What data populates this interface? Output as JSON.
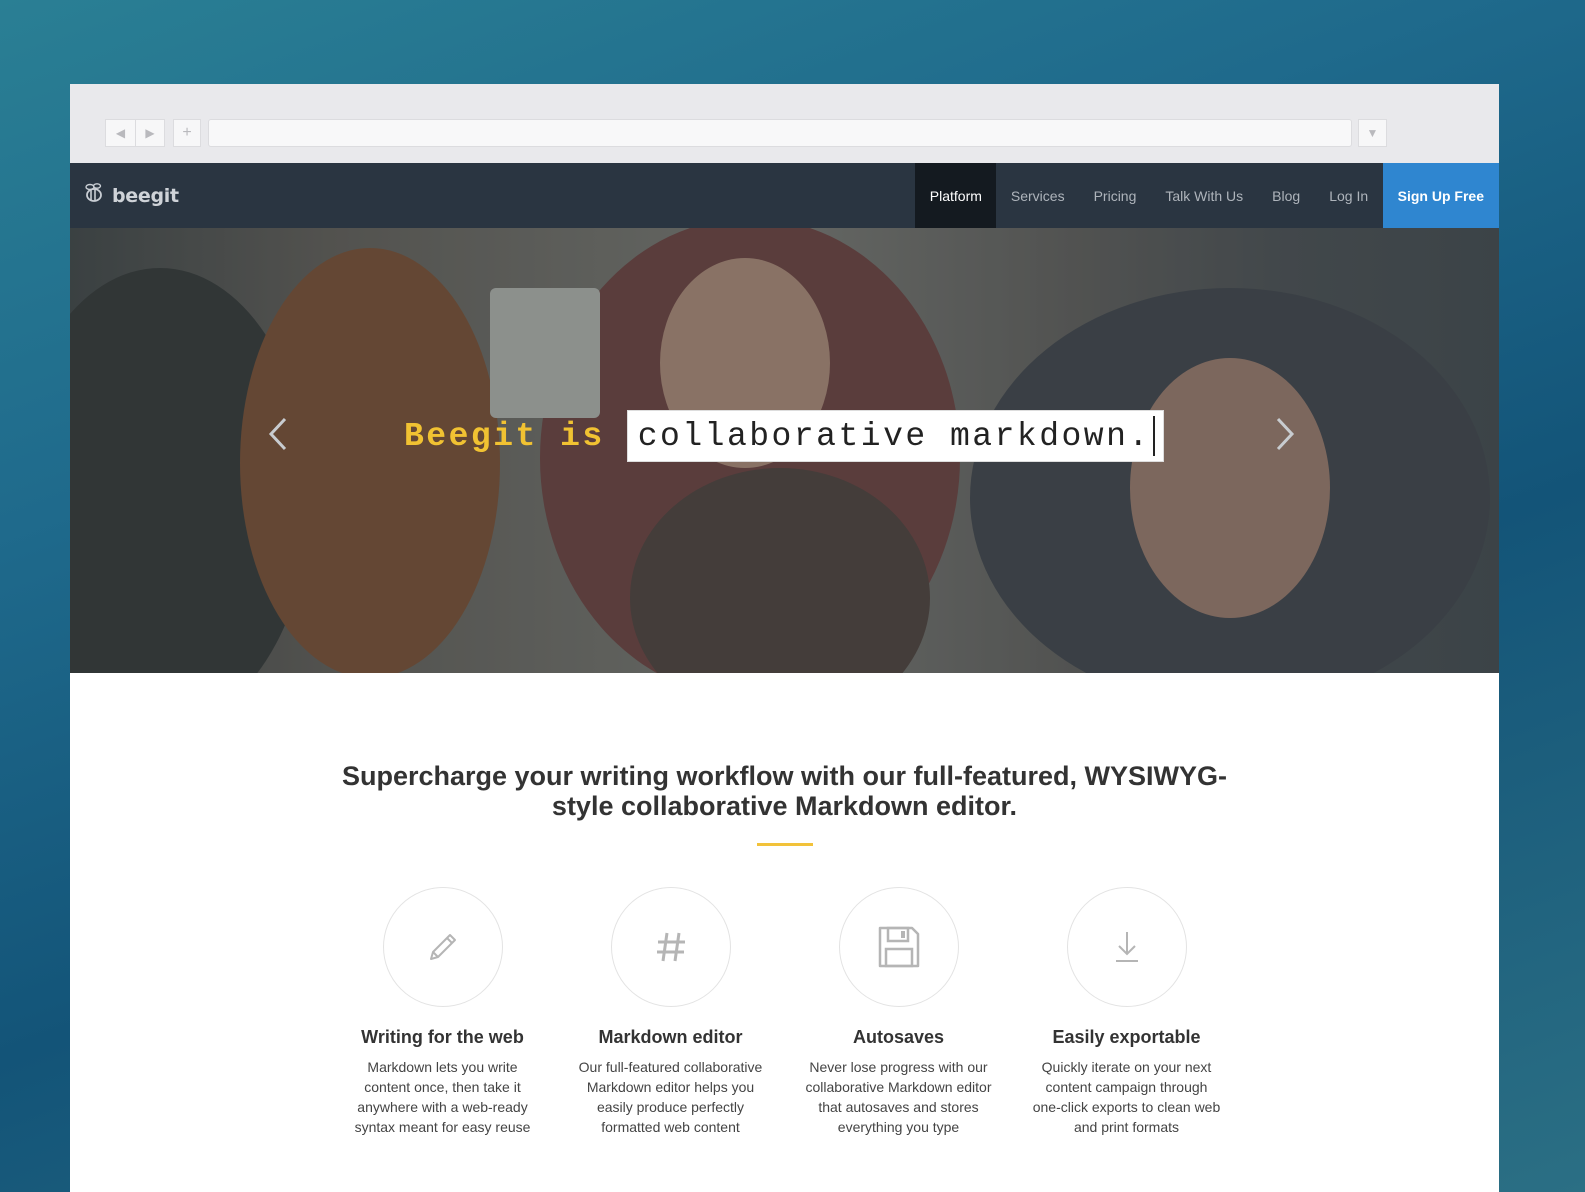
{
  "browser": {
    "back_icon": "back-triangle-icon",
    "forward_icon": "forward-triangle-icon",
    "new_tab_label": "+",
    "url": "",
    "menu_icon": "dropdown-triangle-icon"
  },
  "navbar": {
    "logo_text": "beegit",
    "logo_icon": "bee-icon",
    "items": [
      {
        "label": "Platform",
        "active": true
      },
      {
        "label": "Services"
      },
      {
        "label": "Pricing"
      },
      {
        "label": "Talk With Us"
      },
      {
        "label": "Blog"
      },
      {
        "label": "Log In"
      }
    ],
    "cta_label": "Sign Up Free",
    "colors": {
      "bar": "#2a3541",
      "active": "#141a20",
      "cta": "#2f86d0"
    }
  },
  "hero": {
    "prefix": "Beegit is",
    "typed_text": "collaborative markdown.",
    "prev_icon": "chevron-left-icon",
    "next_icon": "chevron-right-icon",
    "prefix_color": "#f1c232"
  },
  "main": {
    "headline": "Supercharge your writing workflow with our full-featured, WYSIWYG-style collaborative Markdown editor.",
    "accent_color": "#f2c23a",
    "features": [
      {
        "icon": "pencil-icon",
        "title": "Writing for the web",
        "desc": "Markdown lets you write content once, then take it anywhere with a web-ready syntax meant for easy reuse"
      },
      {
        "icon": "hash-icon",
        "title": "Markdown editor",
        "desc": "Our full-featured collaborative Markdown editor helps you easily produce perfectly formatted web content"
      },
      {
        "icon": "floppy-disk-icon",
        "title": "Autosaves",
        "desc": "Never lose progress with our collaborative Markdown editor that autosaves and stores everything you type"
      },
      {
        "icon": "download-icon",
        "title": "Easily exportable",
        "desc": "Quickly iterate on your next content campaign through one-click exports to clean web and print formats"
      }
    ]
  }
}
